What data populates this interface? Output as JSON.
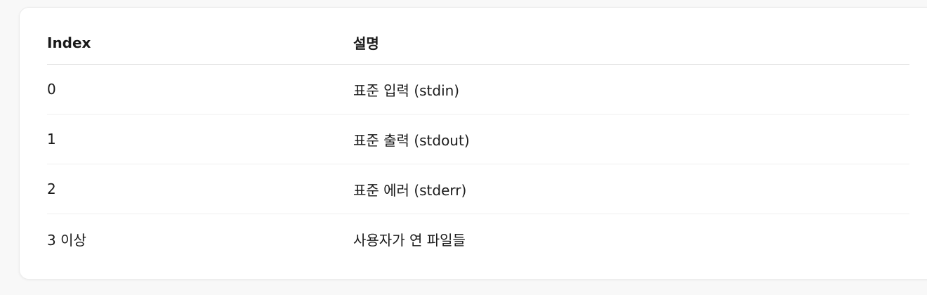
{
  "table": {
    "headers": {
      "index": "Index",
      "description": "설명"
    },
    "rows": [
      {
        "index": "0",
        "description": "표준 입력 (stdin)"
      },
      {
        "index": "1",
        "description": "표준 출력 (stdout)"
      },
      {
        "index": "2",
        "description": "표준 에러 (stderr)"
      },
      {
        "index": "3 이상",
        "description": "사용자가 연 파일들"
      }
    ]
  }
}
